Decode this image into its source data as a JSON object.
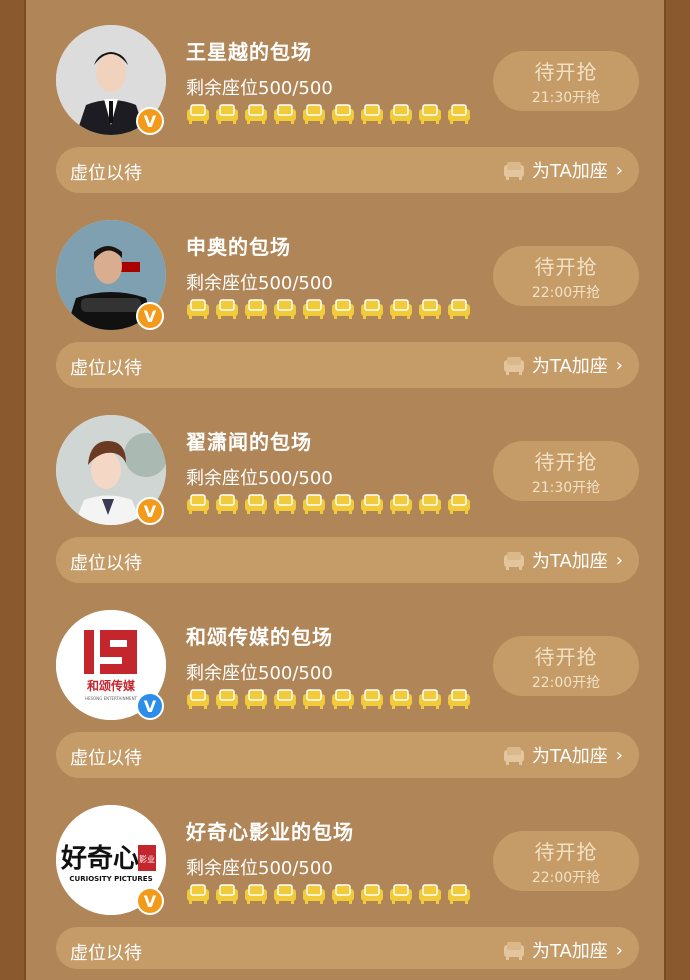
{
  "colors": {
    "accent_seat": "#f2cb3a",
    "button_bg": "#c59b68",
    "badge_orange": "#f39a1b",
    "badge_blue": "#2c8ee8"
  },
  "cards": [
    {
      "title": "王星越的包场",
      "seats": "剩余座位500/500",
      "grab": "待开抢",
      "time": "21:30开抢",
      "waiting": "虚位以待",
      "add": "为TA加座",
      "badge": "V"
    },
    {
      "title": "申奥的包场",
      "seats": "剩余座位500/500",
      "grab": "待开抢",
      "time": "22:00开抢",
      "waiting": "虚位以待",
      "add": "为TA加座",
      "badge": "V"
    },
    {
      "title": "翟潇闻的包场",
      "seats": "剩余座位500/500",
      "grab": "待开抢",
      "time": "21:30开抢",
      "waiting": "虚位以待",
      "add": "为TA加座",
      "badge": "V"
    },
    {
      "title": "和颂传媒的包场",
      "seats": "剩余座位500/500",
      "grab": "待开抢",
      "time": "22:00开抢",
      "waiting": "虚位以待",
      "add": "为TA加座",
      "badge": "V",
      "logo_text": "和颂传媒",
      "logo_sub": "HESONG ENTERTAINMENT"
    },
    {
      "title": "好奇心影业的包场",
      "seats": "剩余座位500/500",
      "grab": "待开抢",
      "time": "22:00开抢",
      "waiting": "虚位以待",
      "add": "为TA加座",
      "badge": "V",
      "logo_text": "好奇心",
      "logo_mark": "影业",
      "logo_sub": "CURIOSITY PICTURES"
    }
  ]
}
